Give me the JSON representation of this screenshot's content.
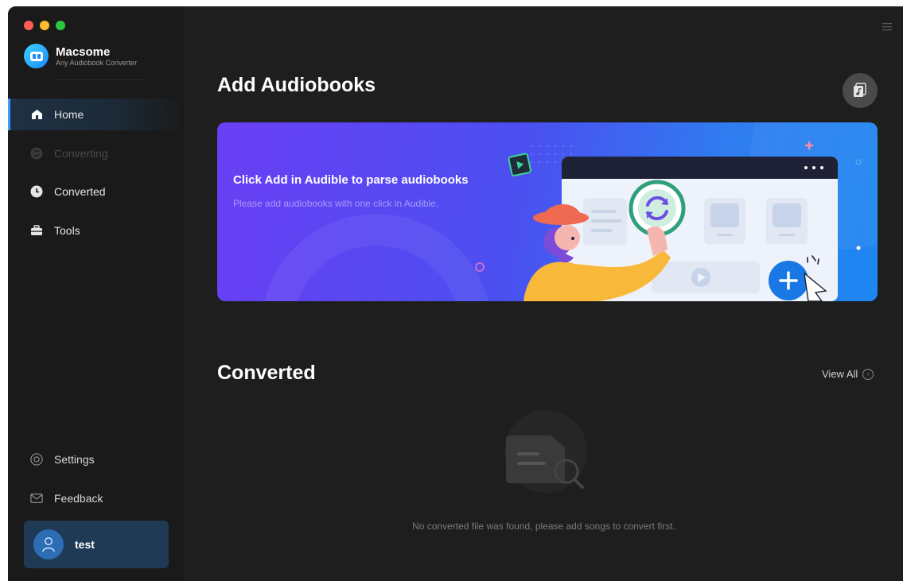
{
  "app": {
    "name": "Macsome",
    "subtitle": "Any Audiobook Converter"
  },
  "sidebar": {
    "items": [
      {
        "label": "Home",
        "icon": "home-icon",
        "state": "active"
      },
      {
        "label": "Converting",
        "icon": "converting-icon",
        "state": "disabled"
      },
      {
        "label": "Converted",
        "icon": "clock-icon",
        "state": "normal"
      },
      {
        "label": "Tools",
        "icon": "toolbox-icon",
        "state": "normal"
      }
    ],
    "bottom_items": [
      {
        "label": "Settings",
        "icon": "gear-icon"
      },
      {
        "label": "Feedback",
        "icon": "mail-icon"
      }
    ],
    "user": {
      "name": "test",
      "icon": "user-icon"
    }
  },
  "main": {
    "add_title": "Add Audiobooks",
    "banner": {
      "title": "Click Add in Audible to parse audiobooks",
      "subtitle": "Please add audiobooks with one click in Audible."
    },
    "converted_title": "Converted",
    "view_all": "View All",
    "empty_message": "No converted file was found, please add songs to convert first."
  },
  "colors": {
    "accent": "#3aa0ff",
    "background": "#1e1e1e",
    "sidebar": "#1a1a1a",
    "user_card": "#1e3a55"
  }
}
